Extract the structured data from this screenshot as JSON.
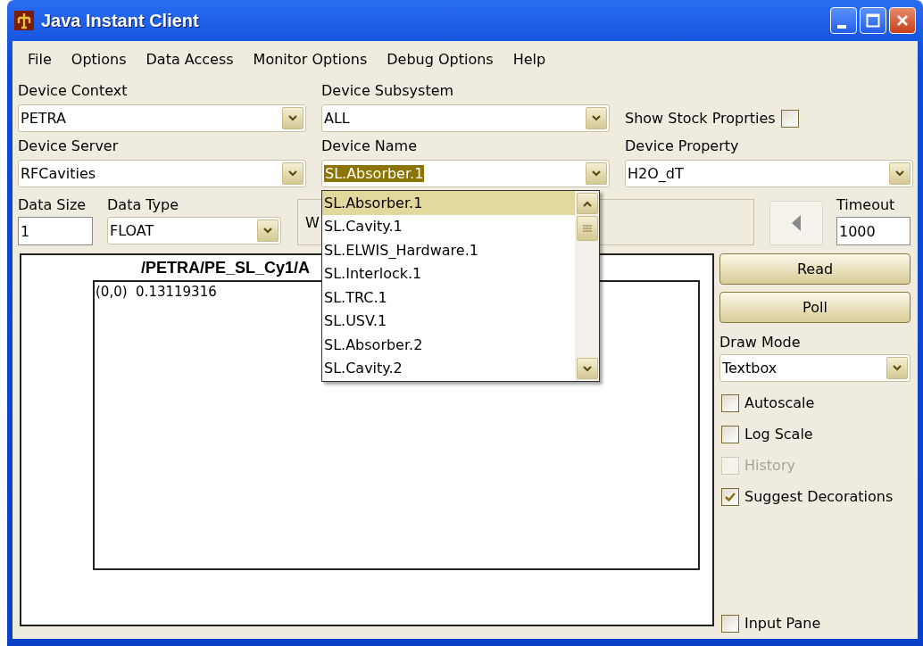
{
  "window": {
    "title": "Java Instant Client"
  },
  "menu": [
    "File",
    "Options",
    "Data Access",
    "Monitor Options",
    "Debug Options",
    "Help"
  ],
  "device_context": {
    "label": "Device Context",
    "value": "PETRA"
  },
  "device_subsystem": {
    "label": "Device Subsystem",
    "value": "ALL"
  },
  "show_stock_properties": {
    "label": "Show Stock Proprties",
    "checked": false
  },
  "device_server": {
    "label": "Device Server",
    "value": "RFCavities"
  },
  "device_name": {
    "label": "Device Name",
    "value": "SL.Absorber.1",
    "text_highlighted": true
  },
  "device_property": {
    "label": "Device Property",
    "value": "H2O_dT"
  },
  "data_size": {
    "label": "Data Size",
    "value": "1"
  },
  "data_type": {
    "label": "Data Type",
    "value": "FLOAT"
  },
  "message": "W",
  "timeout": {
    "label": "Timeout",
    "value": "1000"
  },
  "device_name_list": [
    {
      "label": "SL.Absorber.1",
      "selected": true
    },
    {
      "label": "SL.Cavity.1",
      "selected": false
    },
    {
      "label": "SL.ELWIS_Hardware.1",
      "selected": false
    },
    {
      "label": "SL.Interlock.1",
      "selected": false
    },
    {
      "label": "SL.TRC.1",
      "selected": false
    },
    {
      "label": "SL.USV.1",
      "selected": false
    },
    {
      "label": "SL.Absorber.2",
      "selected": false
    },
    {
      "label": "SL.Cavity.2",
      "selected": false
    }
  ],
  "plot": {
    "title": "/PETRA/PE_SL_Cy1/A",
    "lines": [
      "(0,0)  0.13119316"
    ]
  },
  "buttons": [
    "Read",
    "Poll"
  ],
  "draw_mode": {
    "label": "Draw Mode",
    "value": "Textbox"
  },
  "options": [
    {
      "label": "Autoscale",
      "checked": false,
      "disabled": false
    },
    {
      "label": "Log Scale",
      "checked": false,
      "disabled": false
    },
    {
      "label": "History",
      "checked": false,
      "disabled": true
    },
    {
      "label": "Suggest Decorations",
      "checked": true,
      "disabled": false
    }
  ],
  "input_pane": {
    "label": "Input Pane",
    "checked": false
  }
}
